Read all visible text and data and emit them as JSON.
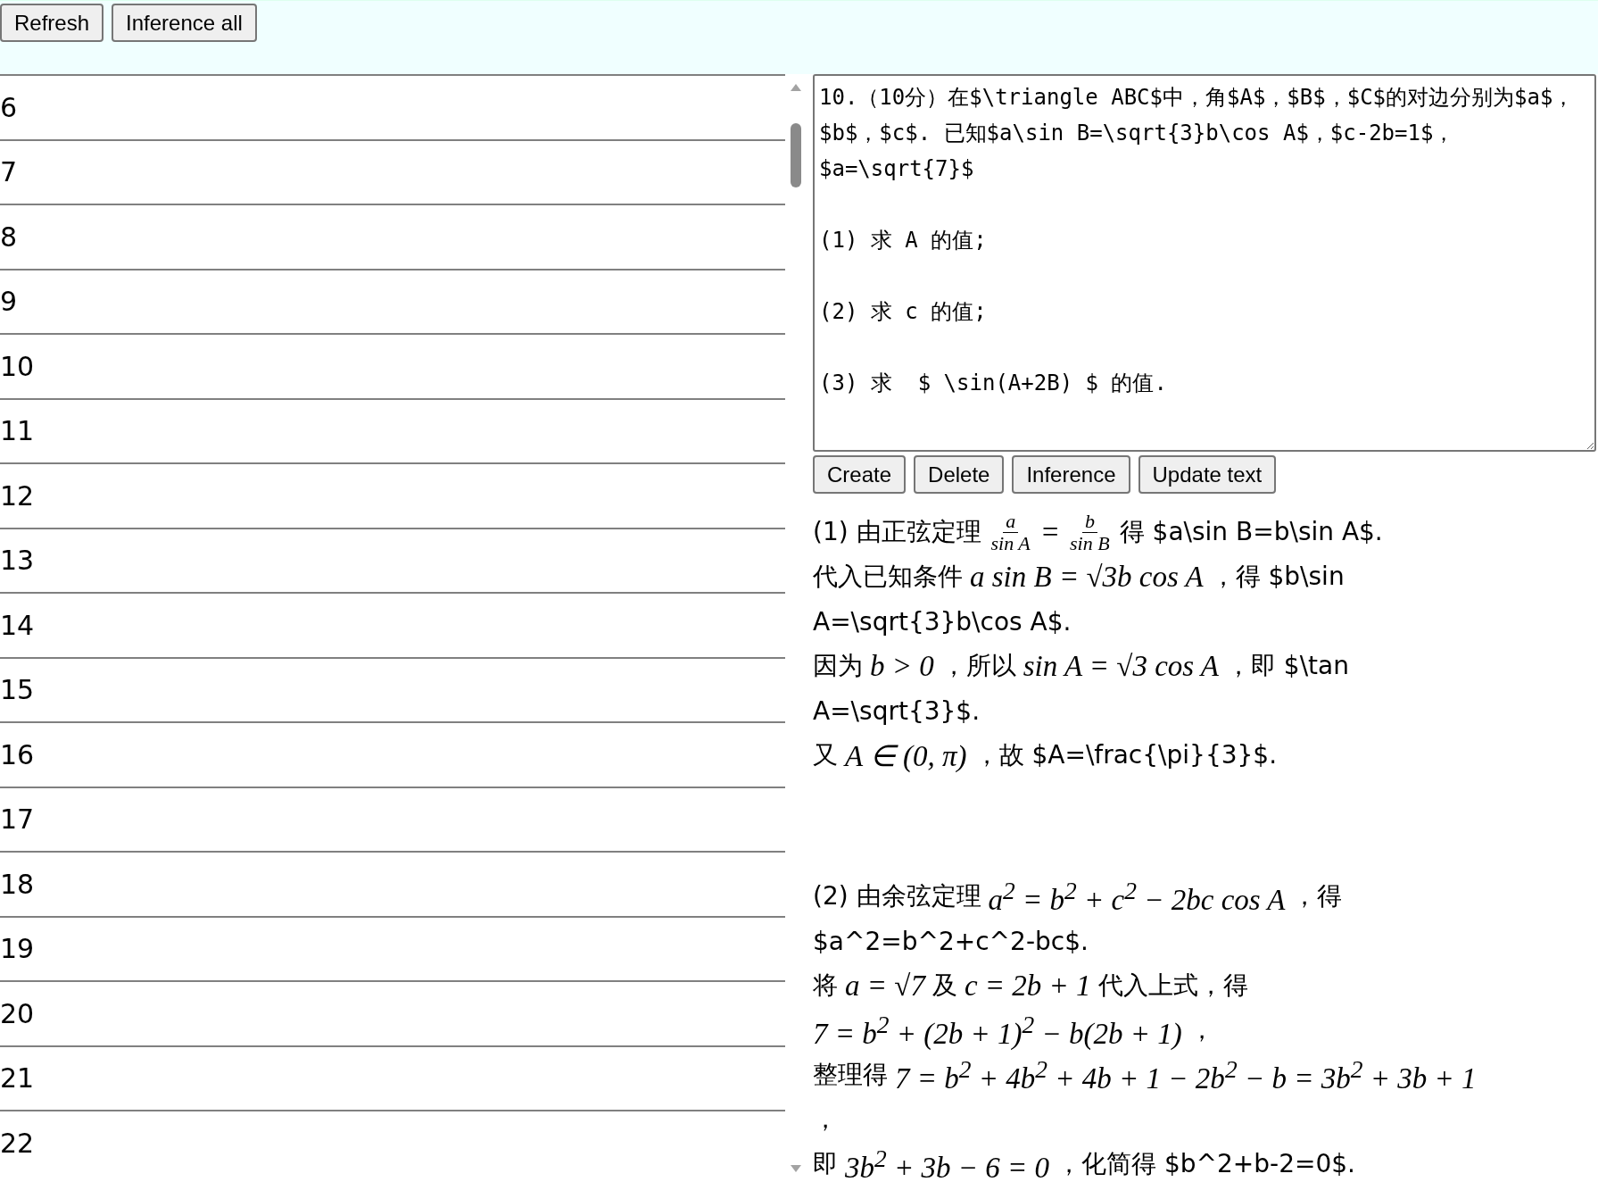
{
  "toolbar": {
    "buttons": [
      "Refresh",
      "Inference all"
    ]
  },
  "list": {
    "items": [
      "6",
      "7",
      "8",
      "9",
      "10",
      "11",
      "12",
      "13",
      "14",
      "15",
      "16",
      "17",
      "18",
      "19",
      "20",
      "21",
      "22"
    ]
  },
  "editor": {
    "value": "10.（10分）在$\\triangle ABC$中，角$A$，$B$，$C$的对边分别为$a$，$b$，$c$. 已知$a\\sin B=\\sqrt{3}b\\cos A$，$c-2b=1$，$a=\\sqrt{7}$\n\n(1) 求 A 的值;\n\n(2) 求 c 的值;\n\n(3) 求  $ \\sin(A+2B) $ 的值.",
    "buttons": [
      "Create",
      "Delete",
      "Inference",
      "Update text"
    ]
  },
  "solution": [
    {
      "lines": [
        [
          {
            "kind": "text",
            "text": "(1) 由正弦定理"
          },
          {
            "kind": "frac",
            "num": "a",
            "den": "sin A"
          },
          {
            "kind": "math",
            "text": "="
          },
          {
            "kind": "frac",
            "num": "b",
            "den": "sin B"
          },
          {
            "kind": "text",
            "text": "得 $a\\sin B=b\\sin A$."
          }
        ],
        [
          {
            "kind": "text",
            "text": "代入已知条件"
          },
          {
            "kind": "math",
            "text": "a sin B = √3b cos A"
          },
          {
            "kind": "text",
            "text": "，得 $b\\sin"
          }
        ],
        [
          {
            "kind": "text",
            "text": "A=\\sqrt{3}b\\cos A$."
          }
        ],
        [
          {
            "kind": "text",
            "text": "因为"
          },
          {
            "kind": "math",
            "text": "b > 0"
          },
          {
            "kind": "text",
            "text": "，所以"
          },
          {
            "kind": "math",
            "text": "sin A = √3 cos A"
          },
          {
            "kind": "text",
            "text": "，即 $\\tan"
          }
        ],
        [
          {
            "kind": "text",
            "text": "A=\\sqrt{3}$."
          }
        ],
        [
          {
            "kind": "text",
            "text": "又"
          },
          {
            "kind": "math",
            "text": "A ∈ (0, π)"
          },
          {
            "kind": "text",
            "text": "，故 $A=\\frac{\\pi}{3}$."
          }
        ]
      ]
    },
    {
      "lines": [
        [
          {
            "kind": "text",
            "text": "(2) 由余弦定理"
          },
          {
            "kind": "math",
            "text": "a$^{2}$ = b$^{2}$ + c$^{2}$ − 2bc cos A"
          },
          {
            "kind": "text",
            "text": "，得"
          }
        ],
        [
          {
            "kind": "text",
            "text": "$a^2=b^2+c^2-bc$."
          }
        ],
        [
          {
            "kind": "text",
            "text": "将"
          },
          {
            "kind": "math",
            "text": "a = √7"
          },
          {
            "kind": "text",
            "text": "及"
          },
          {
            "kind": "math",
            "text": "c = 2b + 1"
          },
          {
            "kind": "text",
            "text": "代入上式，得"
          }
        ],
        [
          {
            "kind": "math",
            "text": "7 = b$^{2}$ + (2b + 1)$^{2}$ − b(2b + 1)"
          },
          {
            "kind": "text",
            "text": "，"
          }
        ],
        [
          {
            "kind": "text",
            "text": "整理得"
          },
          {
            "kind": "math",
            "text": "7 = b$^{2}$ + 4b$^{2}$ + 4b + 1 − 2b$^{2}$ − b = 3b$^{2}$ + 3b + 1"
          }
        ],
        [
          {
            "kind": "text",
            "text": "，"
          }
        ],
        [
          {
            "kind": "text",
            "text": "即"
          },
          {
            "kind": "math",
            "text": "3b$^{2}$ + 3b − 6 = 0"
          },
          {
            "kind": "text",
            "text": "，化简得 $b^2+b-2=0$."
          }
        ]
      ]
    }
  ]
}
